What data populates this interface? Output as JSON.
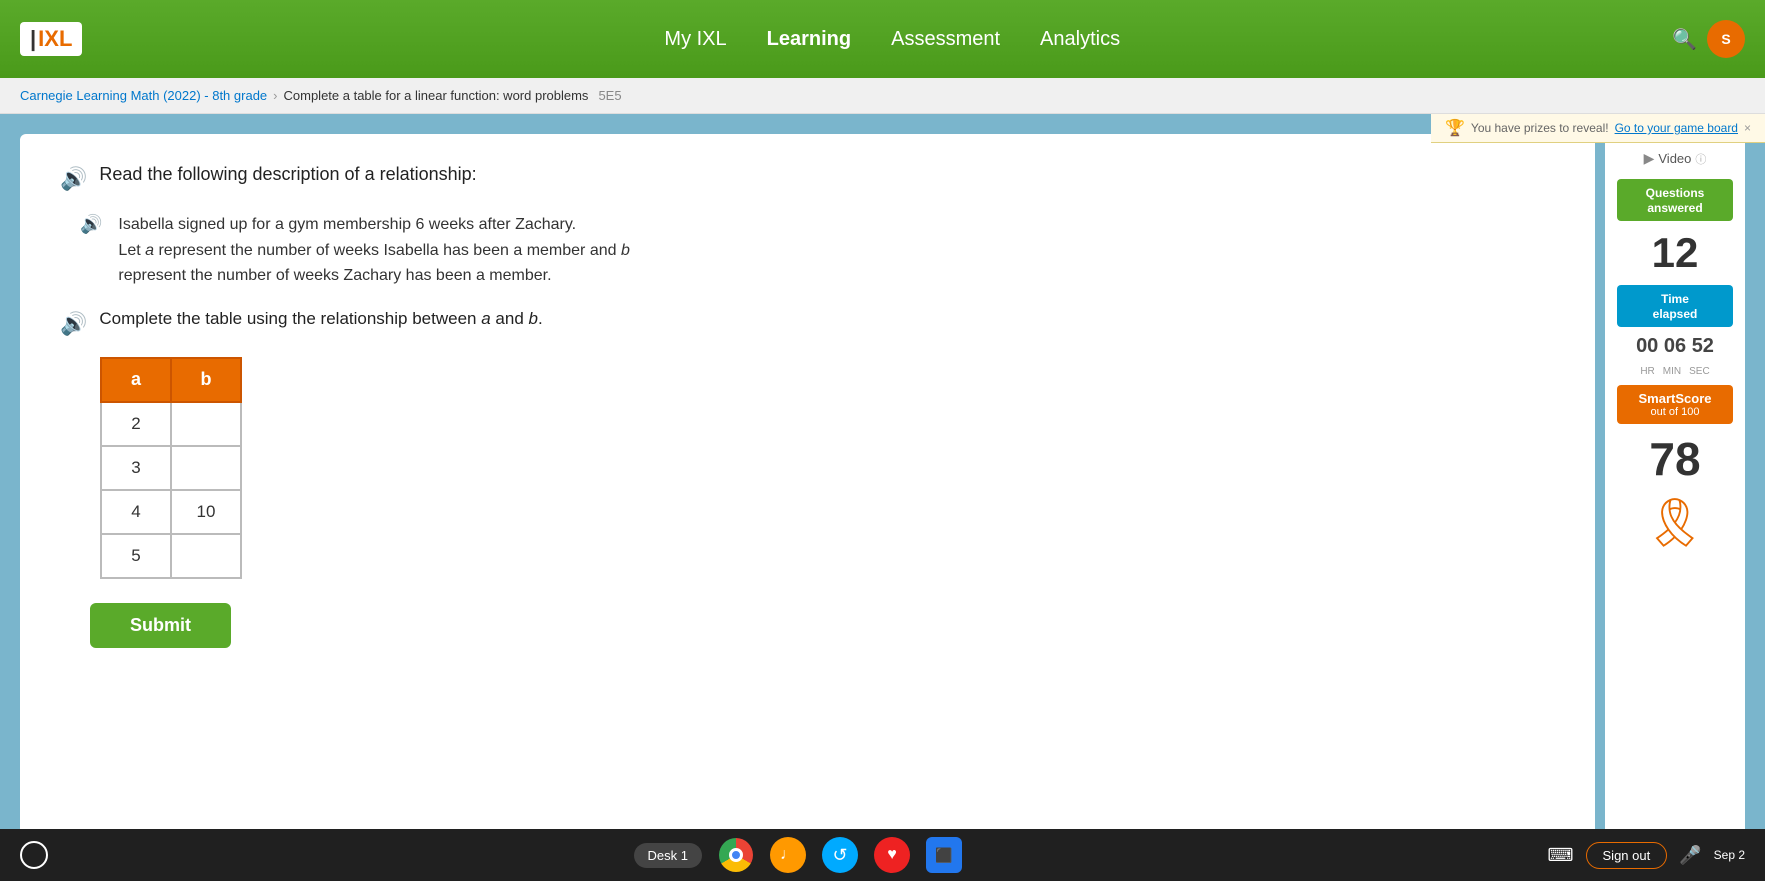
{
  "nav": {
    "logo": "IXL",
    "links": [
      {
        "id": "my-ixl",
        "label": "My IXL"
      },
      {
        "id": "learning",
        "label": "Learning"
      },
      {
        "id": "assessment",
        "label": "Assessment"
      },
      {
        "id": "analytics",
        "label": "Analytics"
      }
    ]
  },
  "breadcrumb": {
    "subject": "Carnegie Learning Math (2022) - 8th grade",
    "separator": "›",
    "topic": "Complete a table for a linear function: word problems",
    "skill_code": "5E5"
  },
  "prize_banner": {
    "text": "You have prizes to reveal!",
    "link_text": "Go to your game board",
    "close": "×"
  },
  "question": {
    "header": "Read the following description of a relationship:",
    "body_line1": "Isabella signed up for a gym membership 6 weeks after Zachary.",
    "body_line2_pre": "Let ",
    "body_a": "a",
    "body_line2_mid": " represent the number of weeks Isabella has been a member and ",
    "body_b": "b",
    "body_line2_post": " represent the number of weeks Zachary has been a member.",
    "instruction": "Complete the table using the relationship between a and b.",
    "table": {
      "headers": [
        "a",
        "b"
      ],
      "rows": [
        {
          "a": "2",
          "b": ""
        },
        {
          "a": "3",
          "b": ""
        },
        {
          "a": "4",
          "b": "10"
        },
        {
          "a": "5",
          "b": ""
        }
      ]
    },
    "submit_label": "Submit"
  },
  "sidebar": {
    "video_label": "Video",
    "questions_answered_label": "Questions\nanswered",
    "questions_answered_count": "12",
    "time_elapsed_label": "Time\nelapsed",
    "timer_hours": "00",
    "timer_mins": "06",
    "timer_secs": "52",
    "timer_label_hr": "HR",
    "timer_label_min": "MIN",
    "timer_label_sec": "SEC",
    "smartscore_label": "SmartScore",
    "smartscore_sublabel": "out of 100",
    "smartscore_value": "78"
  },
  "taskbar": {
    "desk_label": "Desk 1",
    "sign_out_label": "Sign out",
    "time": "Sep 2"
  }
}
